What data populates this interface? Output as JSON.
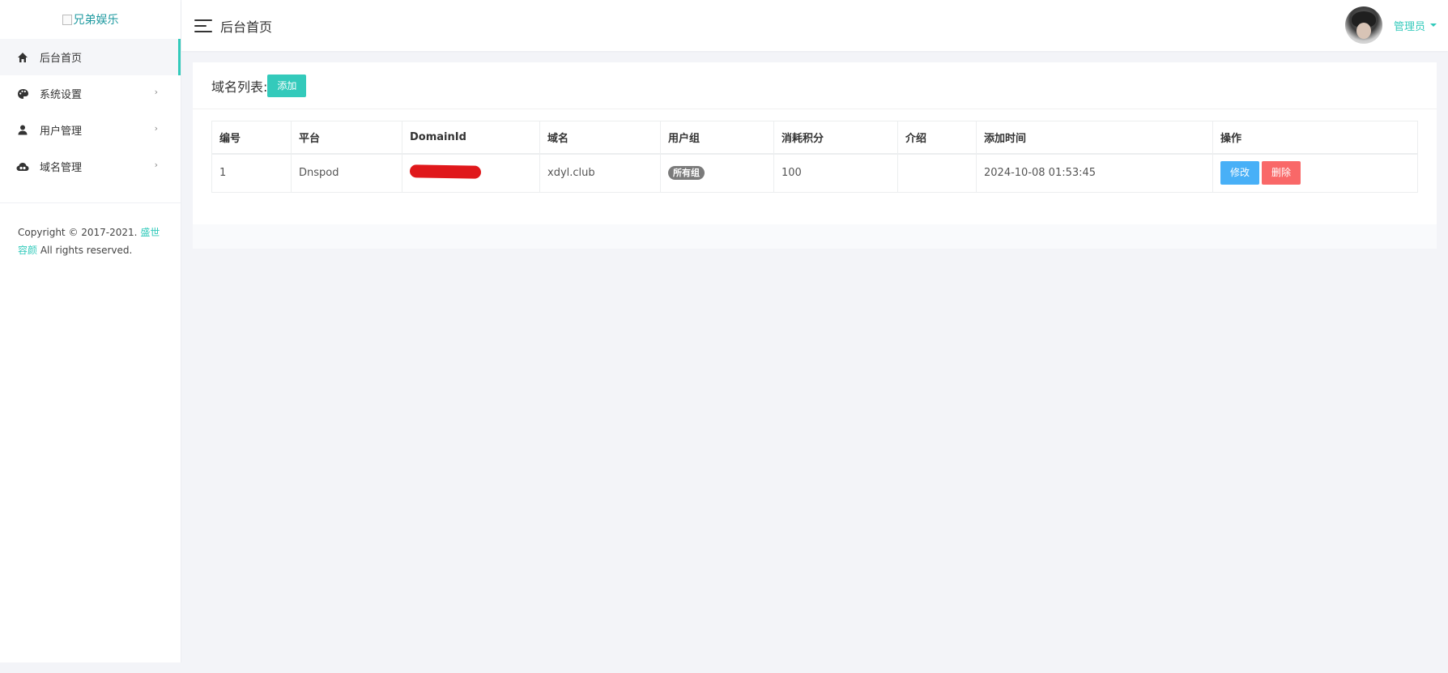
{
  "logo": {
    "alt": "兄弟娱乐"
  },
  "sidebar": {
    "items": [
      {
        "label": "后台首页",
        "icon": "home-icon",
        "active": true
      },
      {
        "label": "系统设置",
        "icon": "palette-icon"
      },
      {
        "label": "用户管理",
        "icon": "user-icon"
      },
      {
        "label": "域名管理",
        "icon": "cloud-icon"
      }
    ],
    "copyright_prefix": "Copyright © 2017-2021. ",
    "copyright_link": "盛世容颜",
    "copyright_suffix": " All rights reserved."
  },
  "header": {
    "title": "后台首页",
    "user_name": "管理员"
  },
  "card": {
    "title": "域名列表:",
    "add_label": "添加"
  },
  "table": {
    "headers": [
      "编号",
      "平台",
      "DomainId",
      "域名",
      "用户组",
      "消耗积分",
      "介绍",
      "添加时间",
      "操作"
    ],
    "rows": [
      {
        "id": "1",
        "platform": "Dnspod",
        "domain_id_redacted": true,
        "domain": "xdyl.club",
        "group": "所有组",
        "points": "100",
        "intro": "",
        "added_at": "2024-10-08 01:53:45",
        "edit_label": "修改",
        "delete_label": "删除"
      }
    ]
  },
  "colors": {
    "accent": "#33cabb",
    "edit": "#48b0f7",
    "delete": "#f96868",
    "badge": "#7b7b7b",
    "redaction": "#e0181b"
  }
}
